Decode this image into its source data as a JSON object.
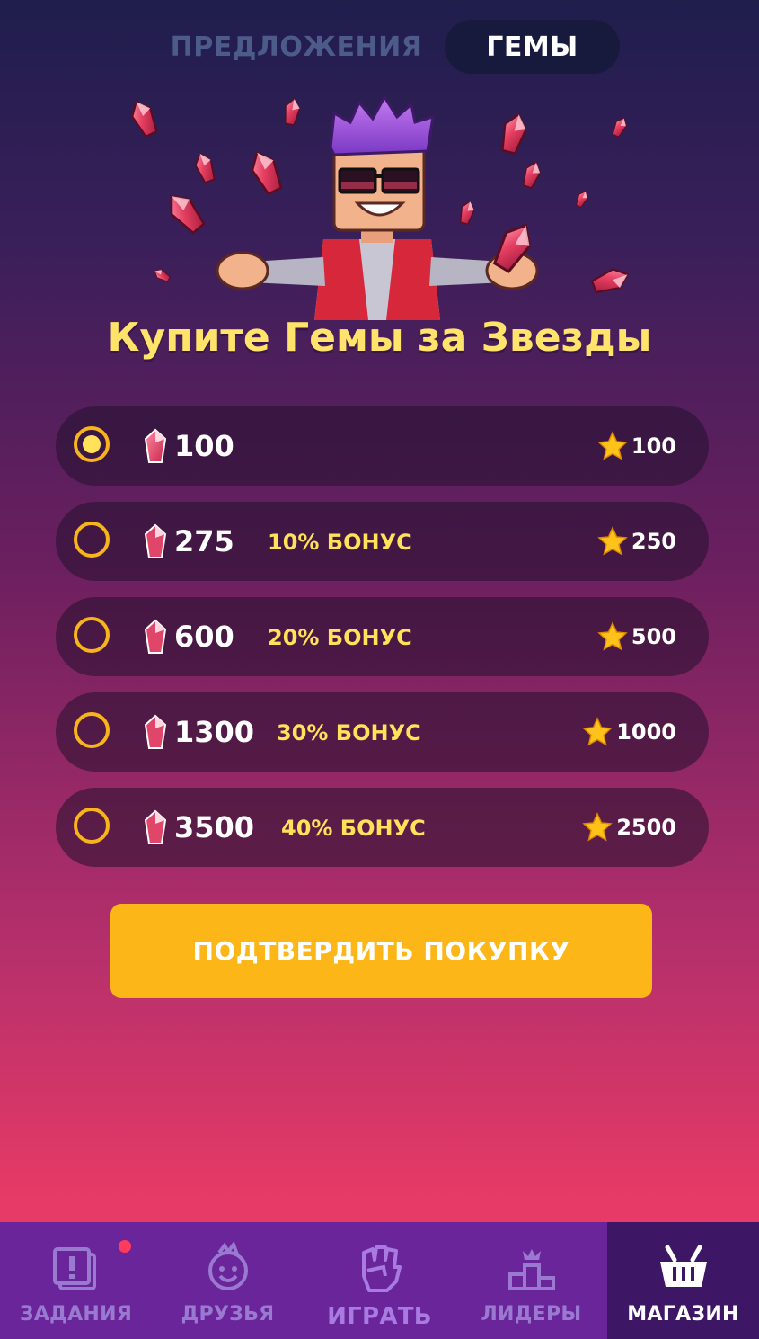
{
  "tabs": {
    "offers": "ПРЕДЛОЖЕНИЯ",
    "gems": "ГЕМЫ",
    "active": "gems"
  },
  "headline": "Купите Гемы за Звезды",
  "packages": [
    {
      "amount": "100",
      "bonus": "",
      "price": "100",
      "selected": true
    },
    {
      "amount": "275",
      "bonus": "10% БОНУС",
      "price": "250",
      "selected": false
    },
    {
      "amount": "600",
      "bonus": "20% БОНУС",
      "price": "500",
      "selected": false
    },
    {
      "amount": "1300",
      "bonus": "30% БОНУС",
      "price": "1000",
      "selected": false
    },
    {
      "amount": "3500",
      "bonus": "40% БОНУС",
      "price": "2500",
      "selected": false
    }
  ],
  "confirm_label": "ПОДТВЕРДИТЬ ПОКУПКУ",
  "nav": {
    "items": [
      {
        "label": "ЗАДАНИЯ",
        "icon": "tasks-icon",
        "notification": true
      },
      {
        "label": "ДРУЗЬЯ",
        "icon": "friends-icon"
      },
      {
        "label": "ИГРАТЬ",
        "icon": "fist-icon"
      },
      {
        "label": "ЛИДЕРЫ",
        "icon": "podium-icon"
      },
      {
        "label": "МАГАЗИН",
        "icon": "basket-icon",
        "active": true
      }
    ]
  },
  "colors": {
    "accent": "#fdb617",
    "gem": "#e63f62",
    "headline": "#ffe36b",
    "bonus": "#ffe15a",
    "nav_bg": "#6b259b",
    "nav_active_bg": "#3d1666"
  }
}
